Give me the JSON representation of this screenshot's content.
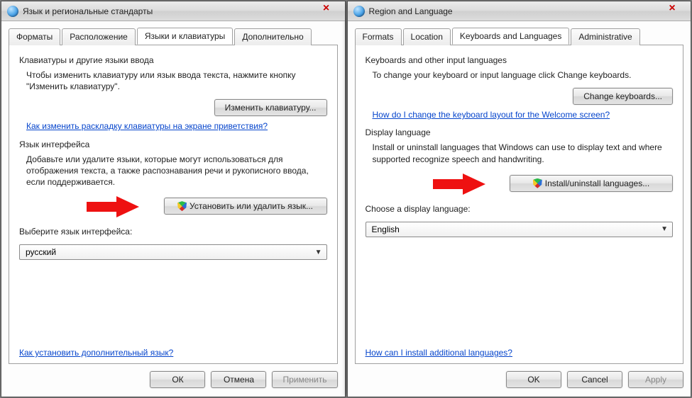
{
  "left": {
    "title": "Язык и региональные стандарты",
    "tabs": [
      "Форматы",
      "Расположение",
      "Языки и клавиатуры",
      "Дополнительно"
    ],
    "active_tab": 2,
    "section1": {
      "title": "Клавиатуры и другие языки ввода",
      "body": "Чтобы изменить клавиатуру или язык ввода текста, нажмите кнопку \"Изменить клавиатуру\".",
      "button": "Изменить клавиатуру...",
      "link": "Как изменить раскладку клавиатуры на экране приветствия?"
    },
    "section2": {
      "title": "Язык интерфейса",
      "body": "Добавьте или удалите языки, которые могут использоваться для отображения текста, а также распознавания речи и рукописного ввода, если             поддерживается.",
      "button": "Установить или удалить язык...",
      "choose_label": "Выберите язык интерфейса:",
      "selected": "русский"
    },
    "bottom_link": "Как установить дополнительный язык?",
    "buttons": {
      "ok": "ОК",
      "cancel": "Отмена",
      "apply": "Применить"
    }
  },
  "right": {
    "title": "Region and Language",
    "tabs": [
      "Formats",
      "Location",
      "Keyboards and Languages",
      "Administrative"
    ],
    "active_tab": 2,
    "section1": {
      "title": "Keyboards and other input languages",
      "body": "To change your keyboard or input language click Change keyboards.",
      "button": "Change keyboards...",
      "link": "How do I change the keyboard layout for the Welcome screen?"
    },
    "section2": {
      "title": "Display language",
      "body": "Install or uninstall languages that Windows can use to display text and where supported recognize speech and handwriting.",
      "button": "Install/uninstall languages...",
      "choose_label": "Choose a display language:",
      "selected": "English"
    },
    "bottom_link": "How can I install additional languages?",
    "buttons": {
      "ok": "OK",
      "cancel": "Cancel",
      "apply": "Apply"
    }
  }
}
